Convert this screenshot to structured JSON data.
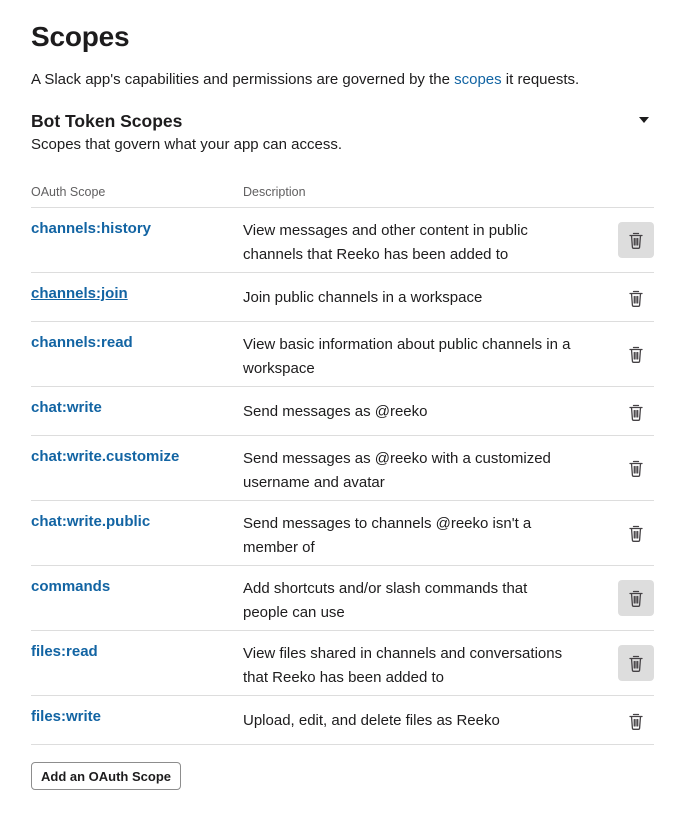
{
  "header": {
    "title": "Scopes",
    "intro_before": "A Slack app's capabilities and permissions are governed by the ",
    "intro_link": "scopes",
    "intro_after": " it requests."
  },
  "section": {
    "title": "Bot Token Scopes",
    "subtitle": "Scopes that govern what your app can access."
  },
  "table": {
    "col_scope": "OAuth Scope",
    "col_description": "Description",
    "rows": [
      {
        "scope": "channels:history",
        "description": "View messages and other content in public channels that Reeko has been added to"
      },
      {
        "scope": "channels:join",
        "description": "Join public channels in a workspace"
      },
      {
        "scope": "channels:read",
        "description": "View basic information about public channels in a workspace"
      },
      {
        "scope": "chat:write",
        "description": "Send messages as @reeko"
      },
      {
        "scope": "chat:write.customize",
        "description": "Send messages as @reeko with a customized username and avatar"
      },
      {
        "scope": "chat:write.public",
        "description": "Send messages to channels @reeko isn't a member of"
      },
      {
        "scope": "commands",
        "description": "Add shortcuts and/or slash commands that people can use"
      },
      {
        "scope": "files:read",
        "description": "View files shared in channels and conversations that Reeko has been added to"
      },
      {
        "scope": "files:write",
        "description": "Upload, edit, and delete files as Reeko"
      }
    ]
  },
  "actions": {
    "add_scope_label": "Add an OAuth Scope"
  },
  "icons": {
    "remove": "trash-icon",
    "collapse": "caret-down-icon"
  },
  "colors": {
    "link": "#1264a3",
    "text": "#1d1c1d",
    "muted": "#616061",
    "divider": "#dddddd"
  }
}
